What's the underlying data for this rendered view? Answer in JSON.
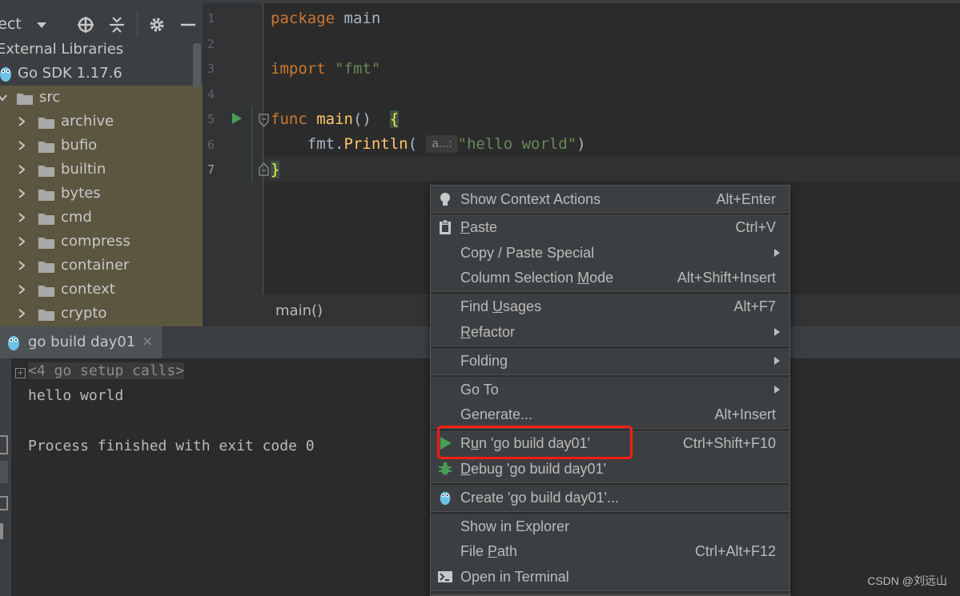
{
  "project": {
    "title": "ject",
    "tree": [
      {
        "label": "External Libraries"
      },
      {
        "label": "Go SDK 1.17.6"
      },
      {
        "label": "src"
      },
      {
        "label": "archive"
      },
      {
        "label": "bufio"
      },
      {
        "label": "builtin"
      },
      {
        "label": "bytes"
      },
      {
        "label": "cmd"
      },
      {
        "label": "compress"
      },
      {
        "label": "container"
      },
      {
        "label": "context"
      },
      {
        "label": "crypto"
      }
    ]
  },
  "editor": {
    "line_numbers": [
      "1",
      "2",
      "3",
      "4",
      "5",
      "6",
      "7"
    ],
    "code": {
      "l1_kw": "package",
      "l1_name": " main",
      "l3_kw": "import",
      "l3_str": " \"fmt\"",
      "l5_kw": "func",
      "l5_fn": " main",
      "l5_rest": "()  ",
      "l5_brace": "{",
      "l6_pkg": "    fmt.",
      "l6_fn": "Println",
      "l6_open": "( ",
      "l6_hint": "a...:",
      "l6_str": "\"hello world\"",
      "l6_close": ")",
      "l7_brace": "}"
    },
    "breadcrumb": "main()"
  },
  "run": {
    "tab_label": "go build day01",
    "tab_close": "×",
    "console": {
      "setup": "<4 go setup calls>",
      "output": "hello world",
      "exit": "Process finished with exit code 0"
    }
  },
  "menu": {
    "show_context_actions": {
      "label": "Show Context Actions",
      "shortcut": "Alt+Enter"
    },
    "paste": {
      "pre": "",
      "u": "P",
      "post": "aste",
      "shortcut": "Ctrl+V"
    },
    "copy_paste_special": {
      "label": "Copy / Paste Special"
    },
    "column_selection": {
      "pre": "Column Selection ",
      "u": "M",
      "post": "ode",
      "shortcut": "Alt+Shift+Insert"
    },
    "find_usages": {
      "pre": "Find ",
      "u": "U",
      "post": "sages",
      "shortcut": "Alt+F7"
    },
    "refactor": {
      "pre": "",
      "u": "R",
      "post": "efactor"
    },
    "folding": {
      "label": "Folding"
    },
    "go_to": {
      "label": "Go To"
    },
    "generate": {
      "label": "Generate...",
      "shortcut": "Alt+Insert"
    },
    "run": {
      "pre": "R",
      "u": "u",
      "post": "n 'go build day01'",
      "shortcut": "Ctrl+Shift+F10"
    },
    "debug": {
      "pre": "",
      "u": "D",
      "post": "ebug 'go build day01'"
    },
    "create": {
      "label": "Create 'go build day01'..."
    },
    "show_in_explorer": {
      "label": "Show in Explorer"
    },
    "file_path": {
      "pre": "File ",
      "u": "P",
      "post": "ath",
      "shortcut": "Ctrl+Alt+F12"
    },
    "open_in_terminal": {
      "label": "Open in Terminal"
    }
  },
  "watermark": "CSDN @刘远山",
  "colors": {
    "run_green": "#499c54",
    "highlight_red": "#ff1d12",
    "folder": "#a9a9a9"
  }
}
